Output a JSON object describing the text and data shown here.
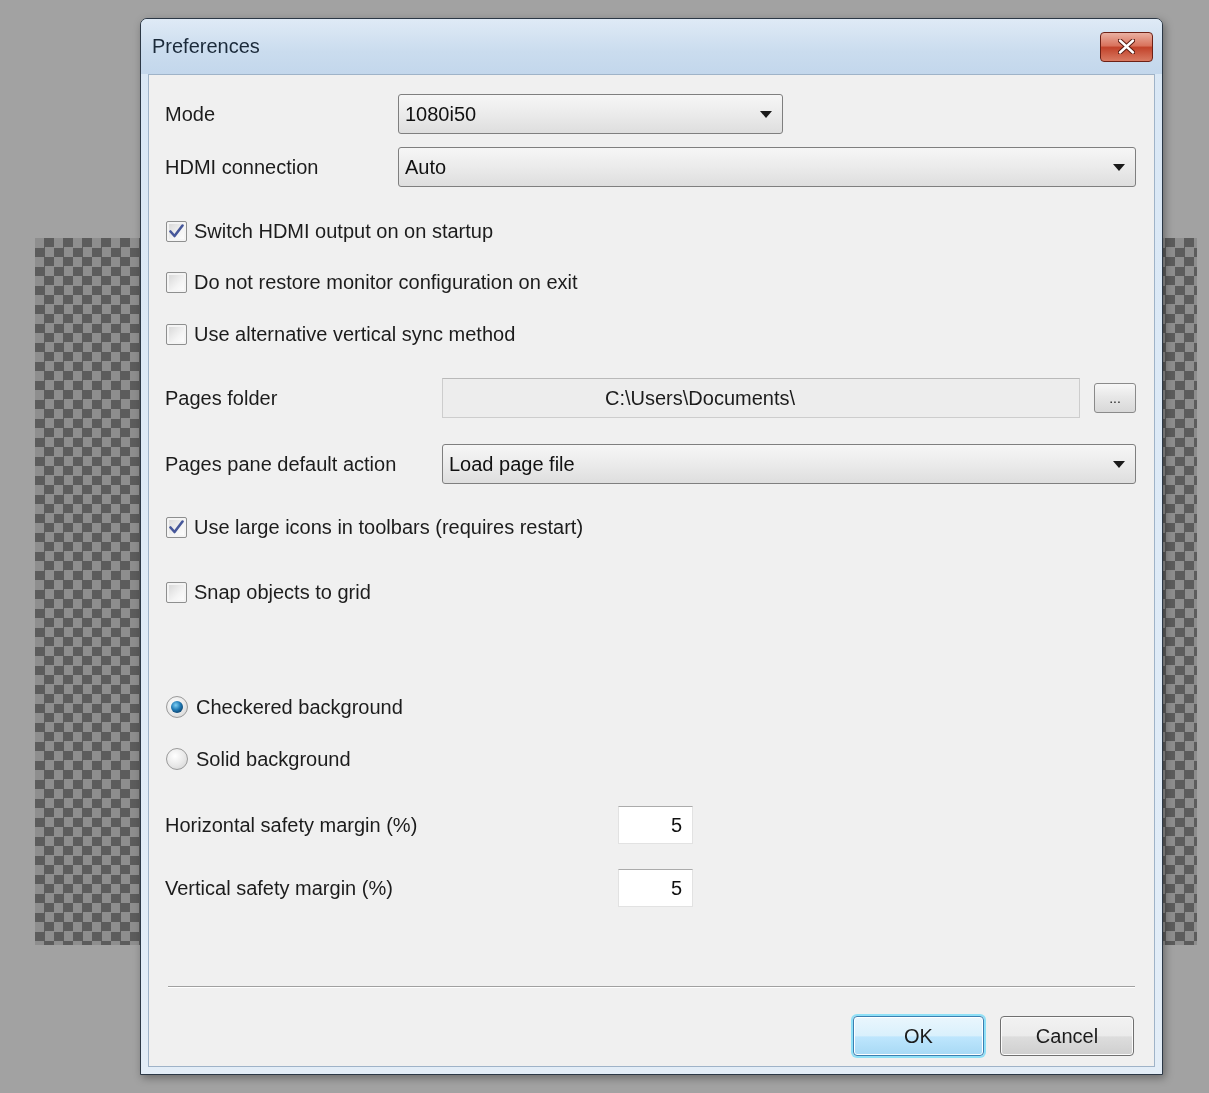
{
  "window": {
    "title": "Preferences"
  },
  "video": [
    {
      "label": "Mode",
      "value": "1080i50"
    },
    {
      "label": "HDMI connection",
      "value": "Auto"
    }
  ],
  "startup_options": [
    {
      "label": "Switch HDMI output on on startup",
      "checked": true
    },
    {
      "label": "Do not restore monitor configuration on exit",
      "checked": false
    },
    {
      "label": "Use alternative vertical sync method",
      "checked": false
    }
  ],
  "pages_folder": {
    "label": "Pages folder",
    "value": "C:\\Users\\Documents\\",
    "browse": "..."
  },
  "pages_action": {
    "label": "Pages pane default action",
    "value": "Load page file"
  },
  "toolbar_options": [
    {
      "label": "Use large icons in toolbars (requires restart)",
      "checked": true
    },
    {
      "label": "Snap objects to grid",
      "checked": false
    }
  ],
  "background": [
    {
      "label": "Checkered background",
      "selected": true
    },
    {
      "label": "Solid background",
      "selected": false
    }
  ],
  "margins": [
    {
      "label": "Horizontal safety margin (%)",
      "value": "5"
    },
    {
      "label": "Vertical safety margin (%)",
      "value": "5"
    }
  ],
  "buttons": [
    {
      "label": "OK",
      "default": true
    },
    {
      "label": "Cancel",
      "default": false
    }
  ]
}
